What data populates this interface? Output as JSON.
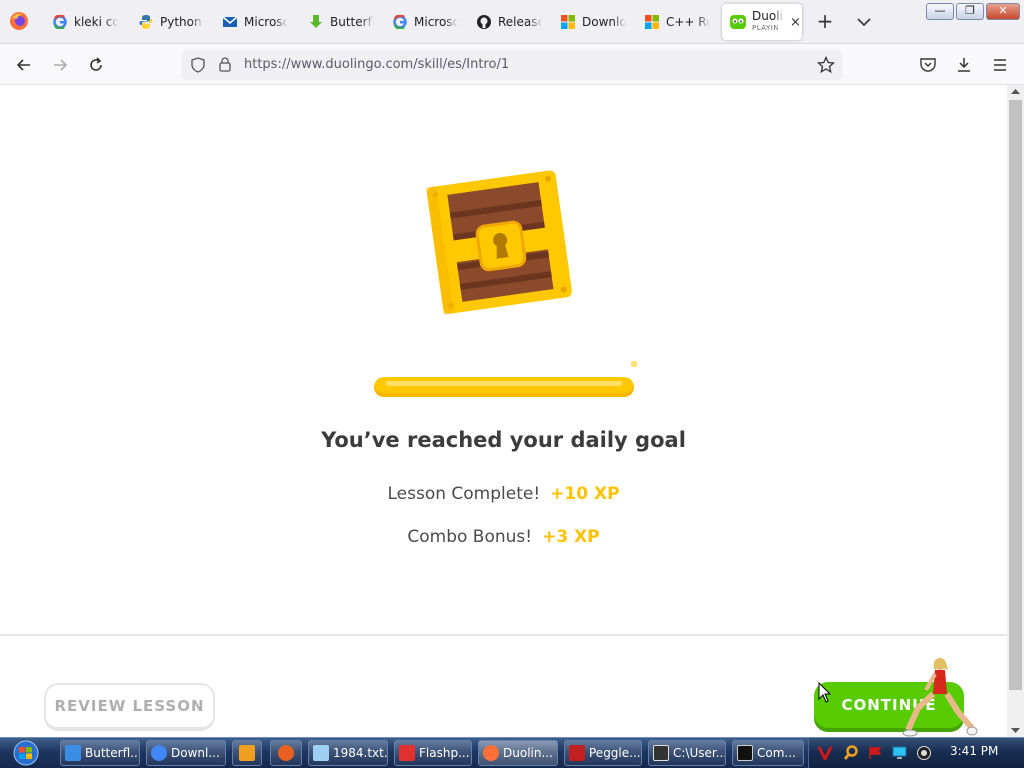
{
  "browser": {
    "tabs": [
      {
        "title": "kleki co",
        "icon": "google-icon"
      },
      {
        "title": "Python",
        "icon": "python-icon"
      },
      {
        "title": "Microsc",
        "icon": "mail-icon"
      },
      {
        "title": "Butterfl",
        "icon": "download-arrow-icon"
      },
      {
        "title": "Microsc",
        "icon": "google-icon"
      },
      {
        "title": "Release",
        "icon": "github-icon"
      },
      {
        "title": "Downlo",
        "icon": "windows-icon"
      },
      {
        "title": "C++ Ru",
        "icon": "windows-icon"
      }
    ],
    "active_tab": {
      "title": "Duoli",
      "subtitle": "PLAYIN",
      "icon": "duolingo-icon",
      "close": "×"
    },
    "new_tab": "+",
    "url": "https://www.duolingo.com/skill/es/Intro/1",
    "window_buttons": {
      "minimize": "—",
      "restore": "❐",
      "close": "✕"
    }
  },
  "lesson": {
    "progress": 1.0,
    "title": "You’ve reached your daily goal",
    "rows": [
      {
        "label": "Lesson Complete!",
        "xp": "+10 XP"
      },
      {
        "label": "Combo Bonus!",
        "xp": "+3 XP"
      }
    ],
    "review_button": "REVIEW LESSON",
    "continue_button": "CONTINUE"
  },
  "taskbar": {
    "items": [
      {
        "label": "Butterfl...",
        "icon": "ie-icon",
        "color": "#3a8ee6"
      },
      {
        "label": "Downl...",
        "icon": "chrome-icon",
        "color": "#4285f4"
      },
      {
        "label": "",
        "icon": "media-player-icon",
        "color": "#f0a020"
      },
      {
        "label": "",
        "icon": "paint-icon",
        "color": "#e86020"
      },
      {
        "label": "1984.txt...",
        "icon": "notepad-icon",
        "color": "#9fd0f0"
      },
      {
        "label": "Flashp...",
        "icon": "flashpoint-icon",
        "color": "#e03030"
      },
      {
        "label": "Duolin...",
        "icon": "firefox-icon",
        "color": "#ff7139"
      },
      {
        "label": "Peggle...",
        "icon": "peggle-icon",
        "color": "#c02020"
      },
      {
        "label": "C:\\User...",
        "icon": "7zip-icon",
        "color": "#333333"
      },
      {
        "label": "Com...",
        "icon": "cmd-icon",
        "color": "#111111"
      }
    ],
    "time": "3:41 PM"
  },
  "colors": {
    "duolingo_green": "#58cc02",
    "xp_gold": "#ffc200",
    "progress_gold": "#ffc800"
  }
}
